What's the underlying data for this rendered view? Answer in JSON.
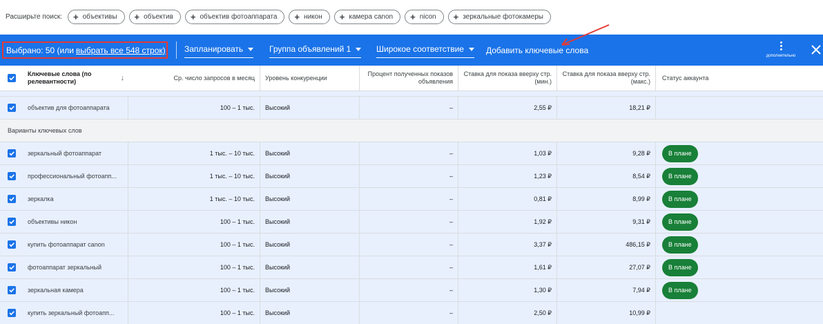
{
  "expand": {
    "label": "Расширьте поиск:",
    "chips": [
      "объективы",
      "объектив",
      "объектив фотоаппарата",
      "никон",
      "камера canon",
      "nicon",
      "зеркальные фотокамеры"
    ]
  },
  "action_bar": {
    "selected_text": "Выбрано: 50 (или",
    "select_all_link": "выбрать все 548 строк)",
    "plan_label": "Запланировать",
    "ad_group_label": "Группа объявлений 1",
    "match_type_label": "Широкое соответствие",
    "add_keywords_label": "Добавить ключевые слова",
    "more_label": "дополнительно"
  },
  "columns": {
    "keyword": "Ключевые слова (по релевантности)",
    "volume": "Ср. число запросов в месяц",
    "competition": "Уровень конкуренции",
    "impr_share": "Процент полученных показов объявления",
    "bid_low": "Ставка для показа вверху стр. (мин.)",
    "bid_high": "Ставка для показа вверху стр. (макс.)",
    "status": "Статус аккаунта"
  },
  "seed_rows": [
    {
      "keyword": "объектив для фотоаппарата",
      "volume": "100 – 1 тыс.",
      "competition": "Высокий",
      "impr_share": "–",
      "bid_low": "2,55 ₽",
      "bid_high": "18,21 ₽",
      "status": ""
    }
  ],
  "group_label": "Варианты ключевых слов",
  "rows": [
    {
      "keyword": "зеркальный фотоаппарат",
      "volume": "1 тыс. – 10 тыс.",
      "competition": "Высокий",
      "impr_share": "–",
      "bid_low": "1,03 ₽",
      "bid_high": "9,28 ₽",
      "status": "В плане"
    },
    {
      "keyword": "профессиональный фотоапп...",
      "volume": "1 тыс. – 10 тыс.",
      "competition": "Высокий",
      "impr_share": "–",
      "bid_low": "1,23 ₽",
      "bid_high": "8,54 ₽",
      "status": "В плане"
    },
    {
      "keyword": "зеркалка",
      "volume": "1 тыс. – 10 тыс.",
      "competition": "Высокий",
      "impr_share": "–",
      "bid_low": "0,81 ₽",
      "bid_high": "8,99 ₽",
      "status": "В плане"
    },
    {
      "keyword": "объективы никон",
      "volume": "100 – 1 тыс.",
      "competition": "Высокий",
      "impr_share": "–",
      "bid_low": "1,92 ₽",
      "bid_high": "9,31 ₽",
      "status": "В плане"
    },
    {
      "keyword": "купить фотоаппарат canon",
      "volume": "100 – 1 тыс.",
      "competition": "Высокий",
      "impr_share": "–",
      "bid_low": "3,37 ₽",
      "bid_high": "486,15 ₽",
      "status": "В плане"
    },
    {
      "keyword": "фотоаппарат зеркальный",
      "volume": "100 – 1 тыс.",
      "competition": "Высокий",
      "impr_share": "–",
      "bid_low": "1,61 ₽",
      "bid_high": "27,07 ₽",
      "status": "В плане"
    },
    {
      "keyword": "зеркальная камера",
      "volume": "100 – 1 тыс.",
      "competition": "Высокий",
      "impr_share": "–",
      "bid_low": "1,30 ₽",
      "bid_high": "7,94 ₽",
      "status": "В плане"
    },
    {
      "keyword": "купить зеркальный фотоапп...",
      "volume": "100 – 1 тыс.",
      "competition": "Высокий",
      "impr_share": "–",
      "bid_low": "2,50 ₽",
      "bid_high": "10,99 ₽",
      "status": ""
    }
  ],
  "colors": {
    "accent": "#1a73e8",
    "badge": "#188038",
    "highlight": "#e53935"
  }
}
